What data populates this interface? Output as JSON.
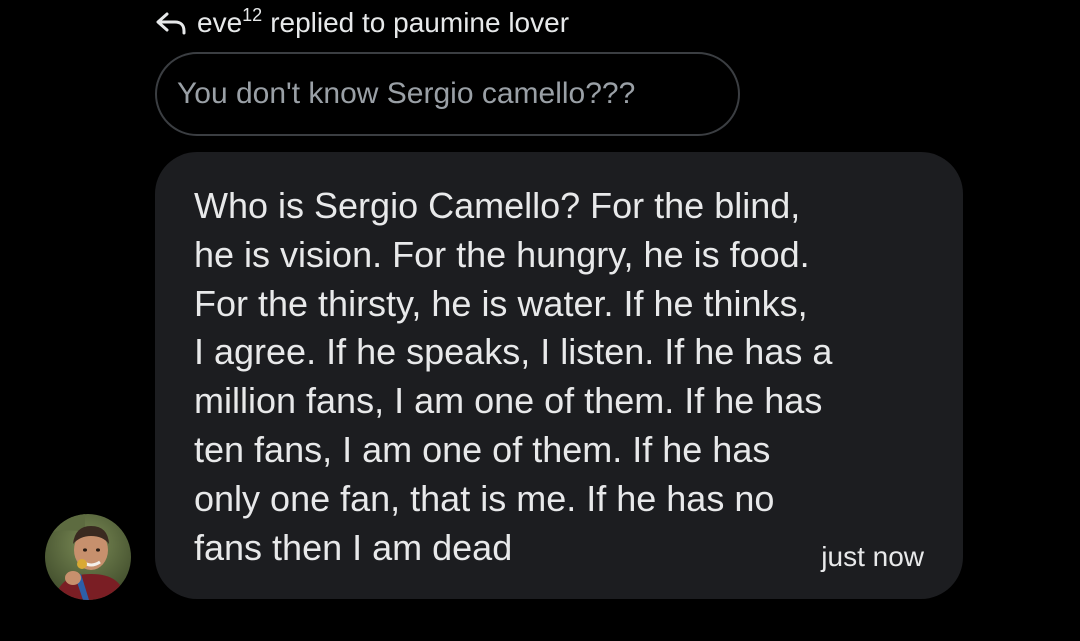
{
  "reply_header": {
    "icon": "reply-arrow-icon",
    "user": "eve",
    "user_superscript": "12",
    "text": "replied to paumine lover"
  },
  "quoted_message": {
    "text": "You don't know Sergio camello???"
  },
  "message": {
    "text": "Who is Sergio Camello? For the blind,\nhe is vision. For the hungry, he is food.\nFor the thirsty, he is water. If he thinks,\nI agree. If he speaks, I listen. If he has a\nmillion fans, I am one of them. If he has\nten fans, I am one of them. If he has\nonly one fan, that is me. If he has no\nfans then I am dead",
    "timestamp": "just now"
  },
  "avatar": {
    "icon": "user-avatar"
  },
  "colors": {
    "background": "#000000",
    "bubble": "#1c1d20",
    "quoted_border": "#3b3e42",
    "quoted_text": "#9aa0a6",
    "text": "#e8e9ea"
  }
}
